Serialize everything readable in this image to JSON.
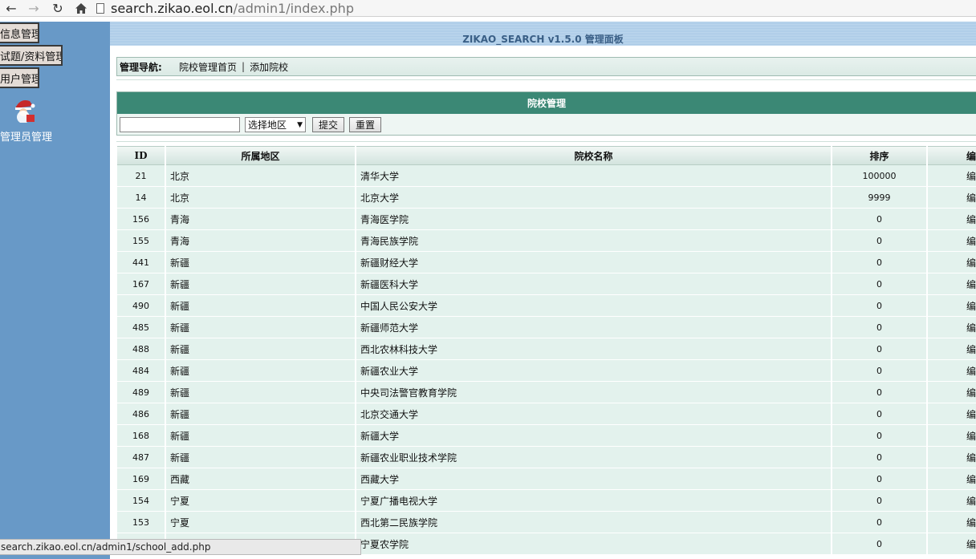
{
  "browser": {
    "url_host": "search.zikao.eol.cn",
    "url_path": "/admin1/index.php",
    "status_url": "search.zikao.eol.cn/admin1/school_add.php"
  },
  "sidebar": {
    "items": [
      {
        "label": "信息管理"
      },
      {
        "label": "试题/资料管理"
      },
      {
        "label": "用户管理"
      }
    ],
    "admin_label": "管理员管理",
    "admin_icon": "santa-avatar-icon"
  },
  "header": {
    "title": "ZIKAO_SEARCH v1.5.0 管理面板"
  },
  "navbar": {
    "label": "管理导航:",
    "links": [
      {
        "label": "院校管理首页"
      },
      {
        "label": "添加院校"
      }
    ],
    "separator": "|"
  },
  "panel": {
    "title": "院校管理",
    "search_value": "",
    "region_select": "选择地区",
    "submit_label": "提交",
    "reset_label": "重置"
  },
  "table": {
    "columns": [
      "ID",
      "所属地区",
      "院校名称",
      "排序",
      "编"
    ],
    "rows": [
      {
        "id": "21",
        "region": "北京",
        "name": "清华大学",
        "order": "100000",
        "op": "编"
      },
      {
        "id": "14",
        "region": "北京",
        "name": "北京大学",
        "order": "9999",
        "op": "编"
      },
      {
        "id": "156",
        "region": "青海",
        "name": "青海医学院",
        "order": "0",
        "op": "编"
      },
      {
        "id": "155",
        "region": "青海",
        "name": "青海民族学院",
        "order": "0",
        "op": "编"
      },
      {
        "id": "441",
        "region": "新疆",
        "name": "新疆财经大学",
        "order": "0",
        "op": "编"
      },
      {
        "id": "167",
        "region": "新疆",
        "name": "新疆医科大学",
        "order": "0",
        "op": "编"
      },
      {
        "id": "490",
        "region": "新疆",
        "name": "中国人民公安大学",
        "order": "0",
        "op": "编"
      },
      {
        "id": "485",
        "region": "新疆",
        "name": "新疆师范大学",
        "order": "0",
        "op": "编"
      },
      {
        "id": "488",
        "region": "新疆",
        "name": "西北农林科技大学",
        "order": "0",
        "op": "编"
      },
      {
        "id": "484",
        "region": "新疆",
        "name": "新疆农业大学",
        "order": "0",
        "op": "编"
      },
      {
        "id": "489",
        "region": "新疆",
        "name": "中央司法警官教育学院",
        "order": "0",
        "op": "编"
      },
      {
        "id": "486",
        "region": "新疆",
        "name": "北京交通大学",
        "order": "0",
        "op": "编"
      },
      {
        "id": "168",
        "region": "新疆",
        "name": "新疆大学",
        "order": "0",
        "op": "编"
      },
      {
        "id": "487",
        "region": "新疆",
        "name": "新疆农业职业技术学院",
        "order": "0",
        "op": "编"
      },
      {
        "id": "169",
        "region": "西藏",
        "name": "西藏大学",
        "order": "0",
        "op": "编"
      },
      {
        "id": "154",
        "region": "宁夏",
        "name": "宁夏广播电视大学",
        "order": "0",
        "op": "编"
      },
      {
        "id": "153",
        "region": "宁夏",
        "name": "西北第二民族学院",
        "order": "0",
        "op": "编"
      },
      {
        "id": "",
        "region": "",
        "name": "宁夏农学院",
        "order": "0",
        "op": "编"
      }
    ]
  }
}
